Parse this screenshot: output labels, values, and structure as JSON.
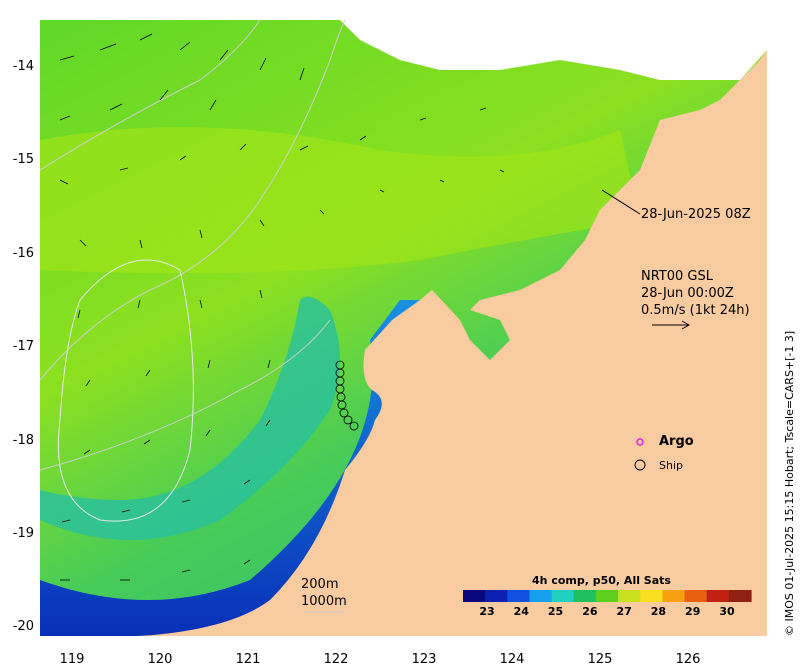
{
  "map": {
    "x_ticks": [
      "119",
      "120",
      "121",
      "122",
      "123",
      "124",
      "125",
      "126"
    ],
    "y_ticks": [
      "-14",
      "-15",
      "-16",
      "-17",
      "-18",
      "-19",
      "-20"
    ],
    "x_range": [
      118.6,
      126.7
    ],
    "y_range": [
      -20.2,
      -13.5
    ],
    "colors": {
      "land": "#f9cba0",
      "warm_sea": "#8fe020",
      "mid_sea": "#40d068",
      "cool_sea": "#20a8e0",
      "cold_sea": "#1830b0",
      "deep_sea": "#081080"
    }
  },
  "annotations": {
    "timestamp": "28-Jun-2025 08Z",
    "current_model": "NRT00 GSL",
    "current_time": "28-Jun 00:00Z",
    "current_scale": "0.5m/s (1kt 24h)",
    "argo_label": "Argo",
    "ship_label": "Ship",
    "depth_200": "200m",
    "depth_1000": "1000m"
  },
  "colorbar": {
    "title": "4h comp, p50, All Sats",
    "ticks": [
      "23",
      "24",
      "25",
      "26",
      "27",
      "28",
      "29",
      "30"
    ],
    "range": [
      22.3,
      30.7
    ],
    "colors": [
      "#08087a",
      "#0a20b0",
      "#1050e0",
      "#18a0f0",
      "#20d0c0",
      "#20c060",
      "#60d020",
      "#c8e020",
      "#f8e020",
      "#f8a010",
      "#e86010",
      "#c02010",
      "#902010"
    ]
  },
  "credit": "© IMOS 01-Jul-2025 15:15 Hobart; Tscale=CARS+[-1 3]"
}
